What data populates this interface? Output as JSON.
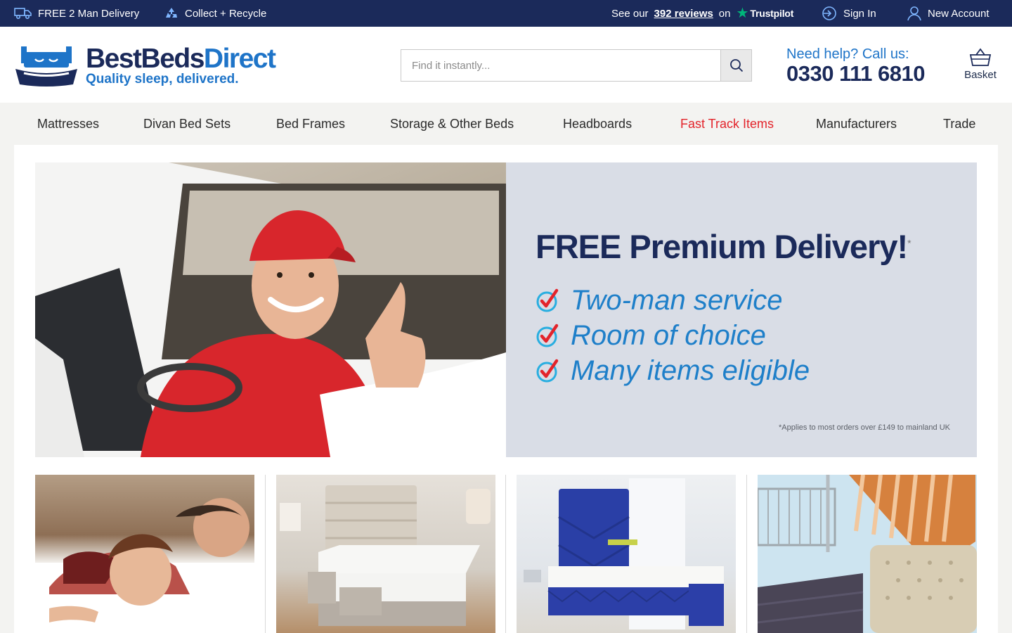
{
  "topbar": {
    "delivery": "FREE 2 Man Delivery",
    "recycle": "Collect + Recycle",
    "reviews_pre": "See our",
    "reviews_count": "392 reviews",
    "reviews_on": "on",
    "trustpilot": "Trustpilot",
    "sign_in": "Sign In",
    "new_account": "New Account"
  },
  "header": {
    "logo_name_a": "BestBeds",
    "logo_name_b": "Direct",
    "logo_tagline": "Quality sleep, delivered.",
    "search_placeholder": "Find it instantly...",
    "help_label": "Need help? Call us:",
    "help_phone": "0330 111 6810",
    "basket": "Basket"
  },
  "nav": [
    {
      "label": "Mattresses"
    },
    {
      "label": "Divan Bed Sets"
    },
    {
      "label": "Bed Frames"
    },
    {
      "label": "Storage & Other Beds"
    },
    {
      "label": "Headboards"
    },
    {
      "label": "Fast Track Items"
    },
    {
      "label": "Manufacturers"
    },
    {
      "label": "Trade"
    }
  ],
  "hero": {
    "title": "FREE Premium Delivery!",
    "title_mark": "*",
    "points": [
      "Two-man service",
      "Room of choice",
      "Many items eligible"
    ],
    "note": "*Applies to most orders over £149 to mainland UK"
  },
  "colors": {
    "navy": "#1b2a5a",
    "brand_blue": "#1e74c8",
    "highlight_red": "#e3242b",
    "trustpilot_green": "#00b67a"
  }
}
